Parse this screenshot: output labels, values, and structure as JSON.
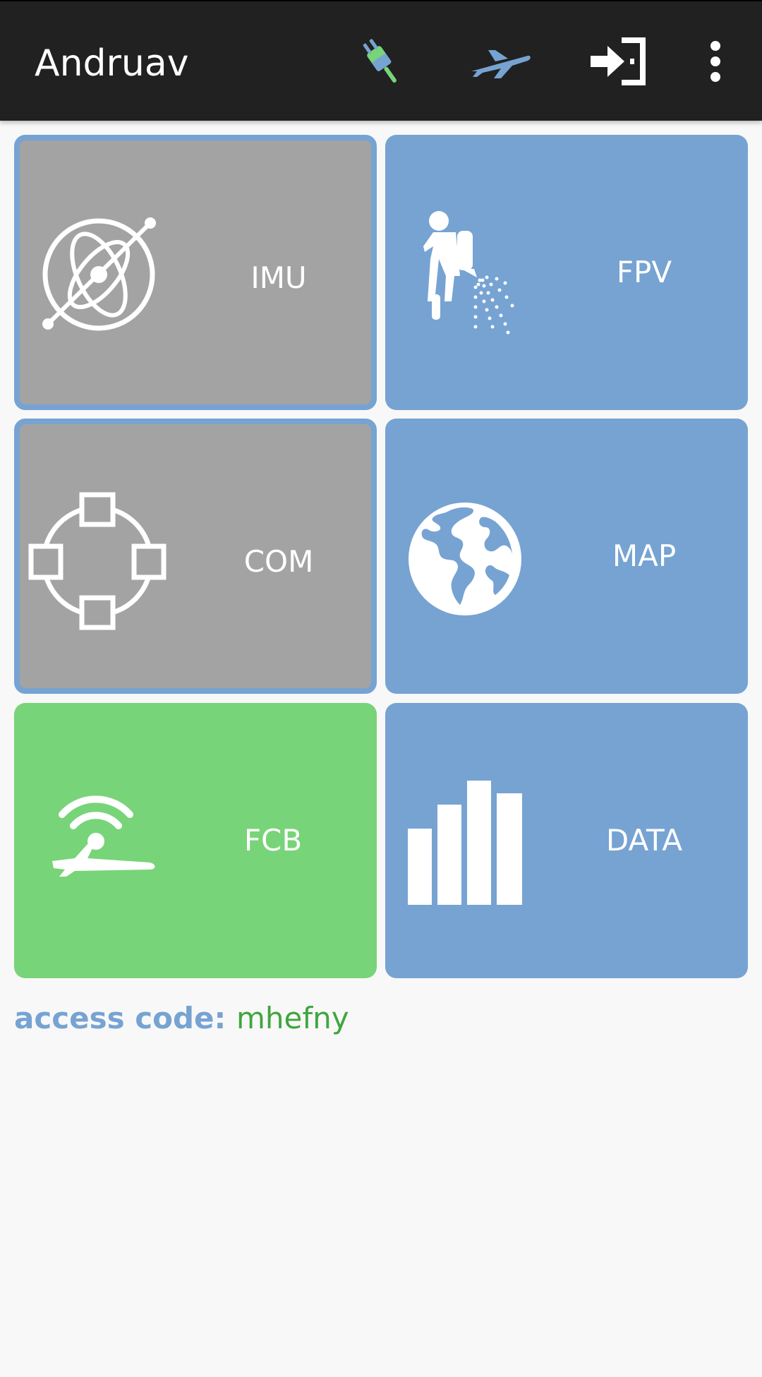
{
  "app_bar": {
    "title": "Andruav",
    "actions": [
      {
        "icon": "plug-icon",
        "color": "#78d478"
      },
      {
        "icon": "airplane-icon",
        "color": "#76a3d2"
      },
      {
        "icon": "exit-door-icon",
        "color": "#ffffff"
      },
      {
        "icon": "more-vert-icon",
        "color": "#ffffff"
      }
    ]
  },
  "tiles": [
    {
      "label": "IMU",
      "icon": "gyroscope-icon",
      "state": "grey"
    },
    {
      "label": "FPV",
      "icon": "sprayer-person-icon",
      "state": "blue"
    },
    {
      "label": "COM",
      "icon": "network-nodes-icon",
      "state": "grey"
    },
    {
      "label": "MAP",
      "icon": "globe-icon",
      "state": "blue"
    },
    {
      "label": "FCB",
      "icon": "wireless-plane-icon",
      "state": "green"
    },
    {
      "label": "DATA",
      "icon": "bar-chart-icon",
      "state": "blue"
    }
  ],
  "access": {
    "label": "access code:",
    "code": "mhefny"
  },
  "colors": {
    "app_bar_bg": "#212121",
    "tile_blue": "#76a3d2",
    "tile_grey": "#a3a3a3",
    "tile_green": "#78d478",
    "access_label": "#76a3d2",
    "access_code": "#3fa63f"
  }
}
